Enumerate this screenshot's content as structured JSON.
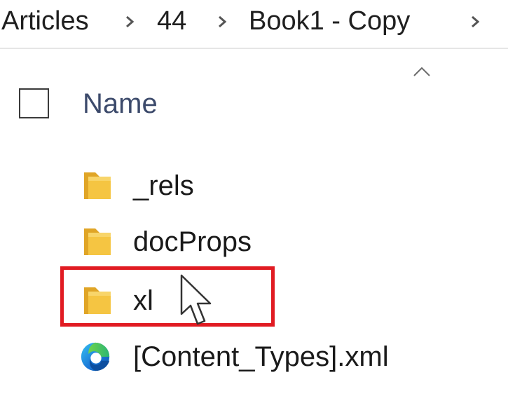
{
  "breadcrumb": {
    "items": [
      "Articles",
      "44",
      "Book1 - Copy"
    ]
  },
  "file_list": {
    "header_name": "Name",
    "items": [
      {
        "name": "_rels",
        "icon": "folder-icon"
      },
      {
        "name": "docProps",
        "icon": "folder-icon"
      },
      {
        "name": "xl",
        "icon": "folder-icon",
        "highlighted": true
      },
      {
        "name": "[Content_Types].xml",
        "icon": "edge-icon"
      }
    ]
  },
  "colors": {
    "highlight": "#e11b22",
    "folder": "#f5c542",
    "header_text": "#3c4a6b"
  }
}
